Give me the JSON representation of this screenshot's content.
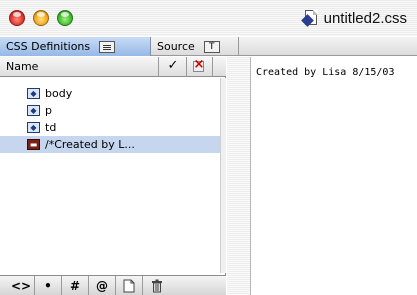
{
  "window": {
    "title": "untitled2.css"
  },
  "tabs": [
    {
      "label": "CSS Definitions",
      "icon": "list-icon",
      "selected": true
    },
    {
      "label": "Source",
      "icon": "text-icon",
      "selected": false
    }
  ],
  "list": {
    "header": {
      "name": "Name",
      "check_icon": "checkmark-icon",
      "x_icon": "x-box-icon"
    },
    "items": [
      {
        "label": "body",
        "icon": "css-selector-icon"
      },
      {
        "label": "p",
        "icon": "css-selector-icon"
      },
      {
        "label": "td",
        "icon": "css-selector-icon"
      },
      {
        "label": "/*Created by L...",
        "icon": "css-comment-icon",
        "selected": true
      }
    ]
  },
  "toolbar": {
    "buttons": [
      {
        "label": "<>",
        "name": "new-tag-button"
      },
      {
        "label": "•",
        "name": "new-class-button"
      },
      {
        "label": "#",
        "name": "new-id-button"
      },
      {
        "label": "@",
        "name": "new-at-rule-button"
      },
      {
        "label": "",
        "name": "new-comment-button",
        "icon": "page-icon"
      },
      {
        "label": "",
        "name": "delete-button",
        "icon": "trash-icon"
      }
    ]
  },
  "source": {
    "text": "Created by Lisa 8/15/03"
  },
  "colors": {
    "selected_tab": "#95b8e6",
    "selected_row": "#c5d6ee"
  }
}
